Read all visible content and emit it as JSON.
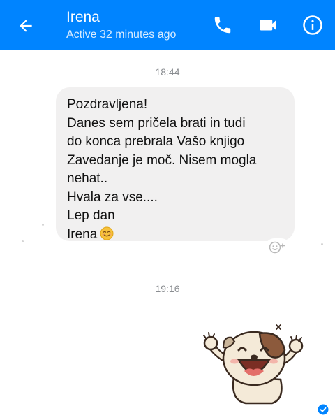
{
  "header": {
    "contact_name": "Irena",
    "status": "Active 32 minutes ago"
  },
  "conversation": {
    "timestamps": [
      "18:44",
      "19:16"
    ],
    "message": {
      "lines": [
        "Pozdravljena!",
        "Danes sem pričela brati in tudi",
        "do konca prebrala Vašo knjigo",
        "Zavedanje je moč. Nisem mogla",
        "nehat..",
        "Hvala za vse....",
        "Lep dan",
        "Irena"
      ],
      "trailing_emoji": "smiling-face-icon"
    },
    "sticker": "laughing-dog-sticker",
    "read_receipt": "seen-check-icon"
  },
  "colors": {
    "header_bg": "#0084ff",
    "bubble_bg": "#f1f0f0",
    "seen_check": "#0084ff"
  }
}
